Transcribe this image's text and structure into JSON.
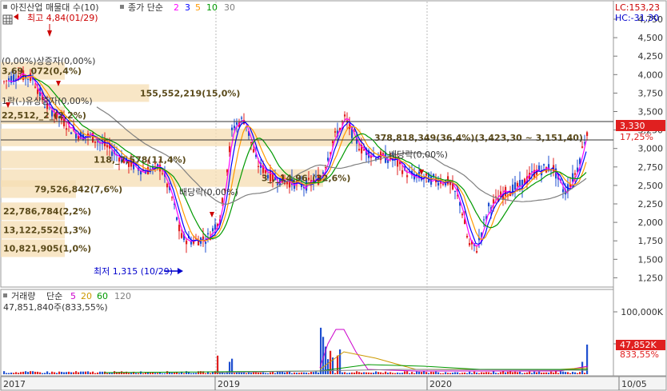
{
  "header": {
    "title": "아진산업 매물대 수(10)",
    "ma_label": "종가 단순",
    "ma_periods": [
      "2",
      "3",
      "5",
      "10",
      "30"
    ],
    "ma_colors": [
      "#ff00ff",
      "#0000ff",
      "#ff9900",
      "#009900",
      "#808080"
    ],
    "lc_label": "LC:153,23",
    "hc_label": "HC:-31,30"
  },
  "volume_header": {
    "title": "거래량",
    "ma_label": "단순",
    "ma_periods": [
      "5",
      "20",
      "60",
      "120"
    ],
    "ma_colors": [
      "#cc00cc",
      "#cc9900",
      "#009900",
      "#808080"
    ],
    "current": "47,851,840주(833,55%)"
  },
  "price_axis": {
    "ticks": [
      "4,750",
      "4,500",
      "4,250",
      "4,000",
      "3,750",
      "3,500",
      "3,250",
      "3,000",
      "2,750",
      "2,500",
      "2,250",
      "2,000",
      "1,750",
      "1,500",
      "1,250"
    ],
    "current_price": "3,330",
    "change_pct": "17,25%"
  },
  "volume_axis": {
    "ticks": [
      "100,000K",
      "50,000K"
    ],
    "current_volume": "47,852K",
    "current_pct": "833,55%"
  },
  "date_axis": [
    "2017",
    "2019",
    "2020",
    "10/05"
  ],
  "annotations": {
    "high": "최고 4,84(01/29)",
    "low": "최저 1,315 (10/29)",
    "event_top": "(0,00%)상증자(0,00%)",
    "event_mid": "1락(-)유상증자(0,00%)",
    "dividend_1": "배당락(0,00%)",
    "dividend_2": "배당락(0,00%)",
    "vp_row1": "3,69_ 072(0,4%)",
    "vp_row2": "22,512,_2_(2,2%)"
  },
  "chart_data": {
    "type": "volume-profile",
    "title": "아진산업 매물대 수(10)",
    "ylim": [
      1250,
      4750
    ],
    "series": [
      {
        "name": "2",
        "ma": true
      },
      {
        "name": "3",
        "ma": true
      },
      {
        "name": "5",
        "ma": true
      },
      {
        "name": "10",
        "ma": true
      },
      {
        "name": "30",
        "ma": true
      }
    ],
    "volume_profile": [
      {
        "price": 4050,
        "label": "3,69_ 072(0,4%)",
        "share": 0.4
      },
      {
        "price": 3750,
        "label": "155,552,219(15,0%)",
        "share": 15.0
      },
      {
        "price": 3450,
        "label": "22,512,_2_(2,2%)",
        "share": 2.2
      },
      {
        "price": 3150,
        "label": "378,818,349(36,4%)(3,423,30 ~ 3,151,40)",
        "share": 36.4
      },
      {
        "price": 2850,
        "label": "118,_7,578(11,4%)",
        "share": 11.4
      },
      {
        "price": 2600,
        "label": "3_,_14,96_(32,6%)",
        "share": 32.6
      },
      {
        "price": 2450,
        "label": "79,526,842(7,6%)",
        "share": 7.6
      },
      {
        "price": 2150,
        "label": "22,786,784(2,2%)",
        "share": 2.2
      },
      {
        "price": 1900,
        "label": "13,122,552(1,3%)",
        "share": 1.3
      },
      {
        "price": 1650,
        "label": "10,821,905(1,0%)",
        "share": 1.0
      }
    ],
    "resistance_lines": [
      3423.3,
      3151.4
    ],
    "high": {
      "value": 4840,
      "date": "01/29"
    },
    "low": {
      "value": 1315,
      "date": "10/29"
    },
    "last_close": 3330,
    "last_change_pct": 17.25,
    "dates": [
      "2017",
      "2019",
      "2020",
      "10/05"
    ],
    "volume_ticks": [
      "100,000K",
      "50,000K"
    ],
    "last_volume": 47851840,
    "last_volume_pct": 833.55
  }
}
